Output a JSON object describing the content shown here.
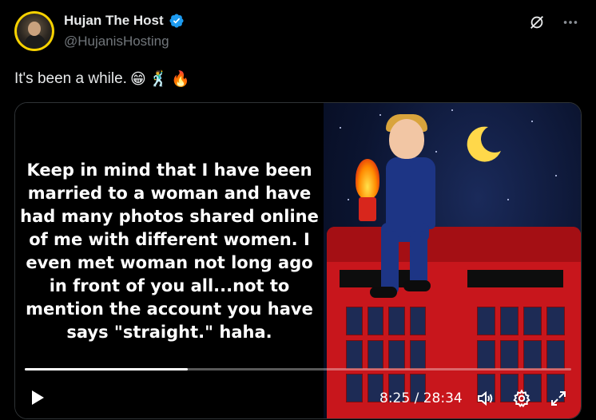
{
  "author": {
    "display_name": "Hujan The Host",
    "handle": "@HujanisHosting",
    "verified": true,
    "avatar_ring_color": "#f7d200"
  },
  "top_actions": [
    {
      "icon": "grok-slash-icon"
    },
    {
      "icon": "more-options-icon"
    }
  ],
  "tweet": {
    "text": "It's been a while.",
    "emojis": [
      "😁",
      "🕺",
      "🔥"
    ]
  },
  "media": {
    "type": "video",
    "caption": "Keep in mind that I have been married to a woman and have had many photos shared online of me with different women. I even met woman not long ago in front of you all...not to mention the account you have says \"straight.\" haha.",
    "progress": 0.298,
    "current_time": "8:25",
    "duration": "28:34",
    "time_display": "8:25 / 28:34",
    "controls": [
      "play-icon",
      "volume-icon",
      "settings-gear-icon",
      "fullscreen-icon"
    ]
  },
  "colors": {
    "background": "#000000",
    "text_primary": "#e7e9ea",
    "text_secondary": "#71767b",
    "verified_blue": "#1d9bf0",
    "booth_red": "#c8161c"
  }
}
